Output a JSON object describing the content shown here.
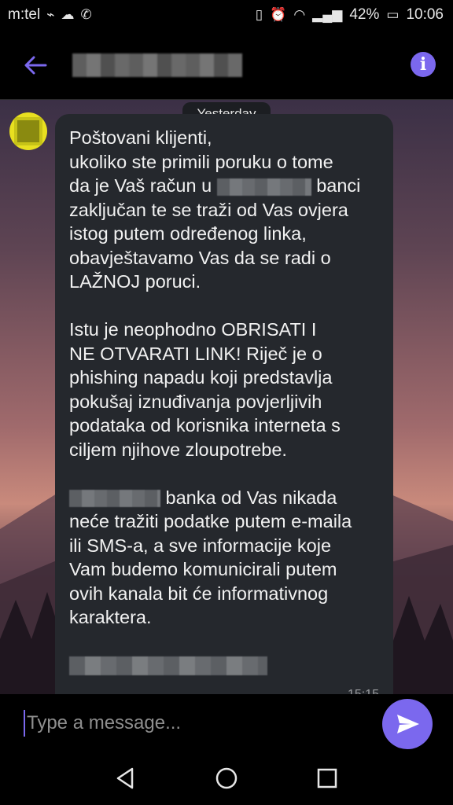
{
  "status_bar": {
    "carrier": "m:tel",
    "battery": "42%",
    "time": "10:06"
  },
  "header": {
    "contact_name_redacted": ""
  },
  "chat": {
    "date_label": "Yesterday",
    "message": {
      "p1_line1": "Poštovani klijenti,",
      "p1_line2": "ukoliko ste primili poruku o tome",
      "p1_line3a": "da je Vaš račun u ",
      "p1_line3b": " banci",
      "p1_line4": "zaključan te se traži od Vas ovjera",
      "p1_line5": "istog putem određenog linka,",
      "p1_line6": "obavještavamo Vas da se radi o",
      "p1_line7": "LAŽNOJ poruci.",
      "p2": "Istu je neophodno OBRISATI I\nNE OTVARATI LINK! Riječ je o\nphishing napadu koji predstavlja\npokušaj iznuđivanja povjerljivih\npodataka od korisnika interneta s\nciljem njihove zloupotrebe.",
      "p3_line1b": " banka od Vas nikada",
      "p3_rest": "neće tražiti podatke putem e-maila\nili SMS-a, a sve informacije koje\nVam budemo komunicirali putem\novih kanala bit će informativnog\nkaraktera.",
      "time": "15:15"
    }
  },
  "composer": {
    "placeholder": "Type a message..."
  },
  "colors": {
    "accent": "#7b68ee",
    "bubble": "#25282d"
  },
  "icons": [
    "back-arrow-icon",
    "info-icon",
    "send-icon",
    "nav-back-icon",
    "nav-home-icon",
    "nav-recents-icon"
  ]
}
